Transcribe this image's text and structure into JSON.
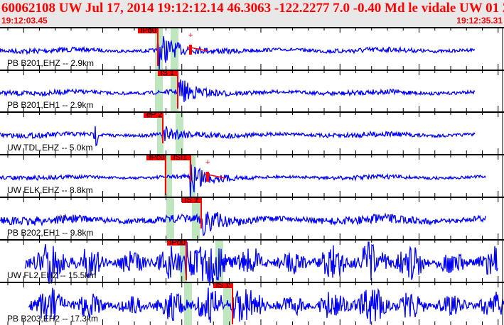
{
  "header": {
    "title": "60062108 UW Jul 17, 2014 19:12:12.14    46.3063 -122.2277  7.0 -0.40 Md le vidale UW 01    2",
    "start_time": "19:12:03.45",
    "end_time": "19:12:35.31"
  },
  "colors": {
    "trace": "#0000ff",
    "pick": "#ff0000",
    "window": "#bfe6bf",
    "header_text": "#ff0000",
    "header_bg": "#e8e8e8"
  },
  "traces": [
    {
      "label": "PB B201,EHZ -- 2.9km",
      "picks": [
        "iPd0"
      ]
    },
    {
      "label": "PB B201,EH1 -- 2.9km",
      "picks": [
        "iS 1"
      ]
    },
    {
      "label": "UW TDL,EHZ -- 5.0km",
      "picks": [
        "eP 2"
      ]
    },
    {
      "label": "UW ELK,EHZ -- 8.8km",
      "picks": [
        "iPc0",
        "iS 1"
      ]
    },
    {
      "label": "PB B202,EH1 -- 9.8km",
      "picks": [
        "iS 1"
      ]
    },
    {
      "label": "UW FL2,EHZ -- 15.5km",
      "picks": [
        "iPd0"
      ]
    },
    {
      "label": "PB B203,EH2 -- 17.3km",
      "picks": [
        "iS 1"
      ]
    }
  ]
}
